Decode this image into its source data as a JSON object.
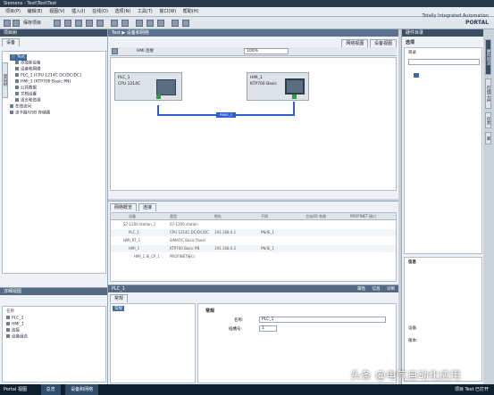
{
  "window": {
    "title": "Siemens - Test\\Test\\Test"
  },
  "menu": [
    "项目(P)",
    "编辑(E)",
    "视图(V)",
    "插入(I)",
    "在线(O)",
    "选项(N)",
    "工具(T)",
    "窗口(W)",
    "帮助(H)"
  ],
  "toolbar": {
    "save_label": "保存项目"
  },
  "brand": {
    "line1": "Totally Integrated Automation",
    "line2": "PORTAL"
  },
  "project_tree": {
    "header": "项目树",
    "tab": "设备",
    "items": [
      "Test",
      "添加新设备",
      "设备和网络",
      "PLC_1 [CPU 1214C DC/DC/DC]",
      "HMI_1 [KTP700 Basic PN]",
      "公共数据",
      "文档设置",
      "语言和资源",
      "在线访问",
      "读卡器/USB 存储器"
    ]
  },
  "details_view": {
    "header": "详细视图",
    "col_name": "名称",
    "items": [
      "PLC_1",
      "HMI_1",
      "连接",
      "设备组态"
    ]
  },
  "editor": {
    "title": "Test ▶ 设备和网络",
    "tabs": [
      "拓扑视图",
      "网络视图",
      "设备视图"
    ],
    "connection_label": "HMI 连接",
    "zoom": "100%",
    "plc": {
      "name": "PLC_1",
      "type": "CPU 1214C"
    },
    "hmi": {
      "name": "HMI_1",
      "type": "KTP700 Basic"
    },
    "link_label": "PN/IE_1"
  },
  "network_table": {
    "tabs": [
      "网络概览",
      "连接"
    ],
    "columns": [
      "设备",
      "类型",
      "地址",
      "子网",
      "主站/IO 系统",
      "PROFINET 接口"
    ],
    "rows": [
      [
        "S7-1200 station_1",
        "S7-1200 station",
        "",
        "",
        "",
        ""
      ],
      [
        "PLC_1",
        "CPU 1214C DC/DC/DC",
        "192.168.0.1",
        "PN/IE_1",
        "",
        ""
      ],
      [
        "HMI_RT_1",
        "SIMATIC Basic Panel",
        "",
        "",
        "",
        ""
      ],
      [
        "HMI_1",
        "KTP700 Basic PN",
        "192.168.0.2",
        "PN/IE_1",
        "",
        ""
      ],
      [
        "HMI_1.IE_CP_1",
        "PROFINET接口",
        "",
        "",
        "",
        ""
      ]
    ]
  },
  "properties": {
    "header": "PLC_1",
    "tabs": [
      "属性",
      "信息",
      "诊断"
    ],
    "left_tab": "常规",
    "left_item": "常规",
    "section": "常规",
    "field_name_label": "名称:",
    "field_name_value": "PLC_1",
    "field_num_label": "插槽号:",
    "field_num_value": "1"
  },
  "task_cards": {
    "header": "硬件目录",
    "options_label": "选项",
    "catalog_label": "目录",
    "info_label": "信息",
    "info_device": "设备:",
    "info_version": "版本:",
    "vtabs": [
      "硬件目录",
      "在线工具",
      "任务",
      "库"
    ]
  },
  "taskbar": {
    "portal_view": "Portal 视图",
    "items": [
      "总览",
      "设备和网络"
    ],
    "status": "项目 Test 已打开"
  },
  "watermark": "头条 @电气自动化应用"
}
